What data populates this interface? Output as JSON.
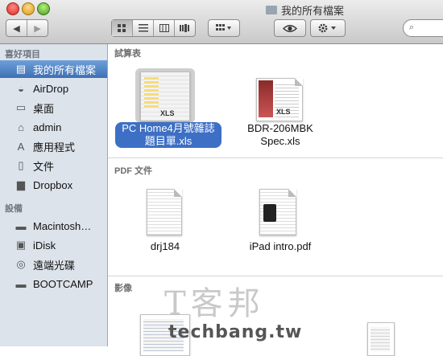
{
  "window": {
    "title": "我的所有檔案"
  },
  "toolbar": {
    "back": "◀",
    "forward": "▶",
    "view_buttons": [
      "icon-view",
      "list-view",
      "column-view",
      "coverflow-view"
    ],
    "arrange": "arrange-menu",
    "quicklook": "quicklook",
    "action": "action-menu"
  },
  "sidebar": {
    "favorites_header": "喜好項目",
    "devices_header": "設備",
    "favorites": [
      {
        "label": "我的所有檔案",
        "icon": "all-files-icon",
        "selected": true
      },
      {
        "label": "AirDrop",
        "icon": "airdrop-icon"
      },
      {
        "label": "桌面",
        "icon": "desktop-icon"
      },
      {
        "label": "admin",
        "icon": "home-icon"
      },
      {
        "label": "應用程式",
        "icon": "applications-icon"
      },
      {
        "label": "文件",
        "icon": "documents-icon"
      },
      {
        "label": "Dropbox",
        "icon": "folder-icon"
      }
    ],
    "devices": [
      {
        "label": "Macintosh…",
        "icon": "hard-drive-icon"
      },
      {
        "label": "iDisk",
        "icon": "idisk-icon"
      },
      {
        "label": "遠端光碟",
        "icon": "remote-disc-icon"
      },
      {
        "label": "BOOTCAMP",
        "icon": "hard-drive-icon"
      }
    ]
  },
  "content": {
    "sections": [
      {
        "label": "試算表",
        "files": [
          {
            "name_line1": "PC Home4月號雜誌",
            "name_line2": "題目單.xls",
            "badge": "XLS",
            "selected": true
          },
          {
            "name_line1": "BDR-206MBK",
            "name_line2": "Spec.xls",
            "badge": "XLS"
          }
        ]
      },
      {
        "label": "PDF 文件",
        "files": [
          {
            "name_line1": "drj184"
          },
          {
            "name_line1": "iPad intro.pdf"
          }
        ]
      },
      {
        "label": "影像",
        "files": []
      }
    ]
  },
  "watermark": {
    "cn": "T客邦",
    "en": "techbang.tw"
  },
  "colors": {
    "selection": "#3d6fc4",
    "sidebar_bg": "#dde3ea"
  }
}
